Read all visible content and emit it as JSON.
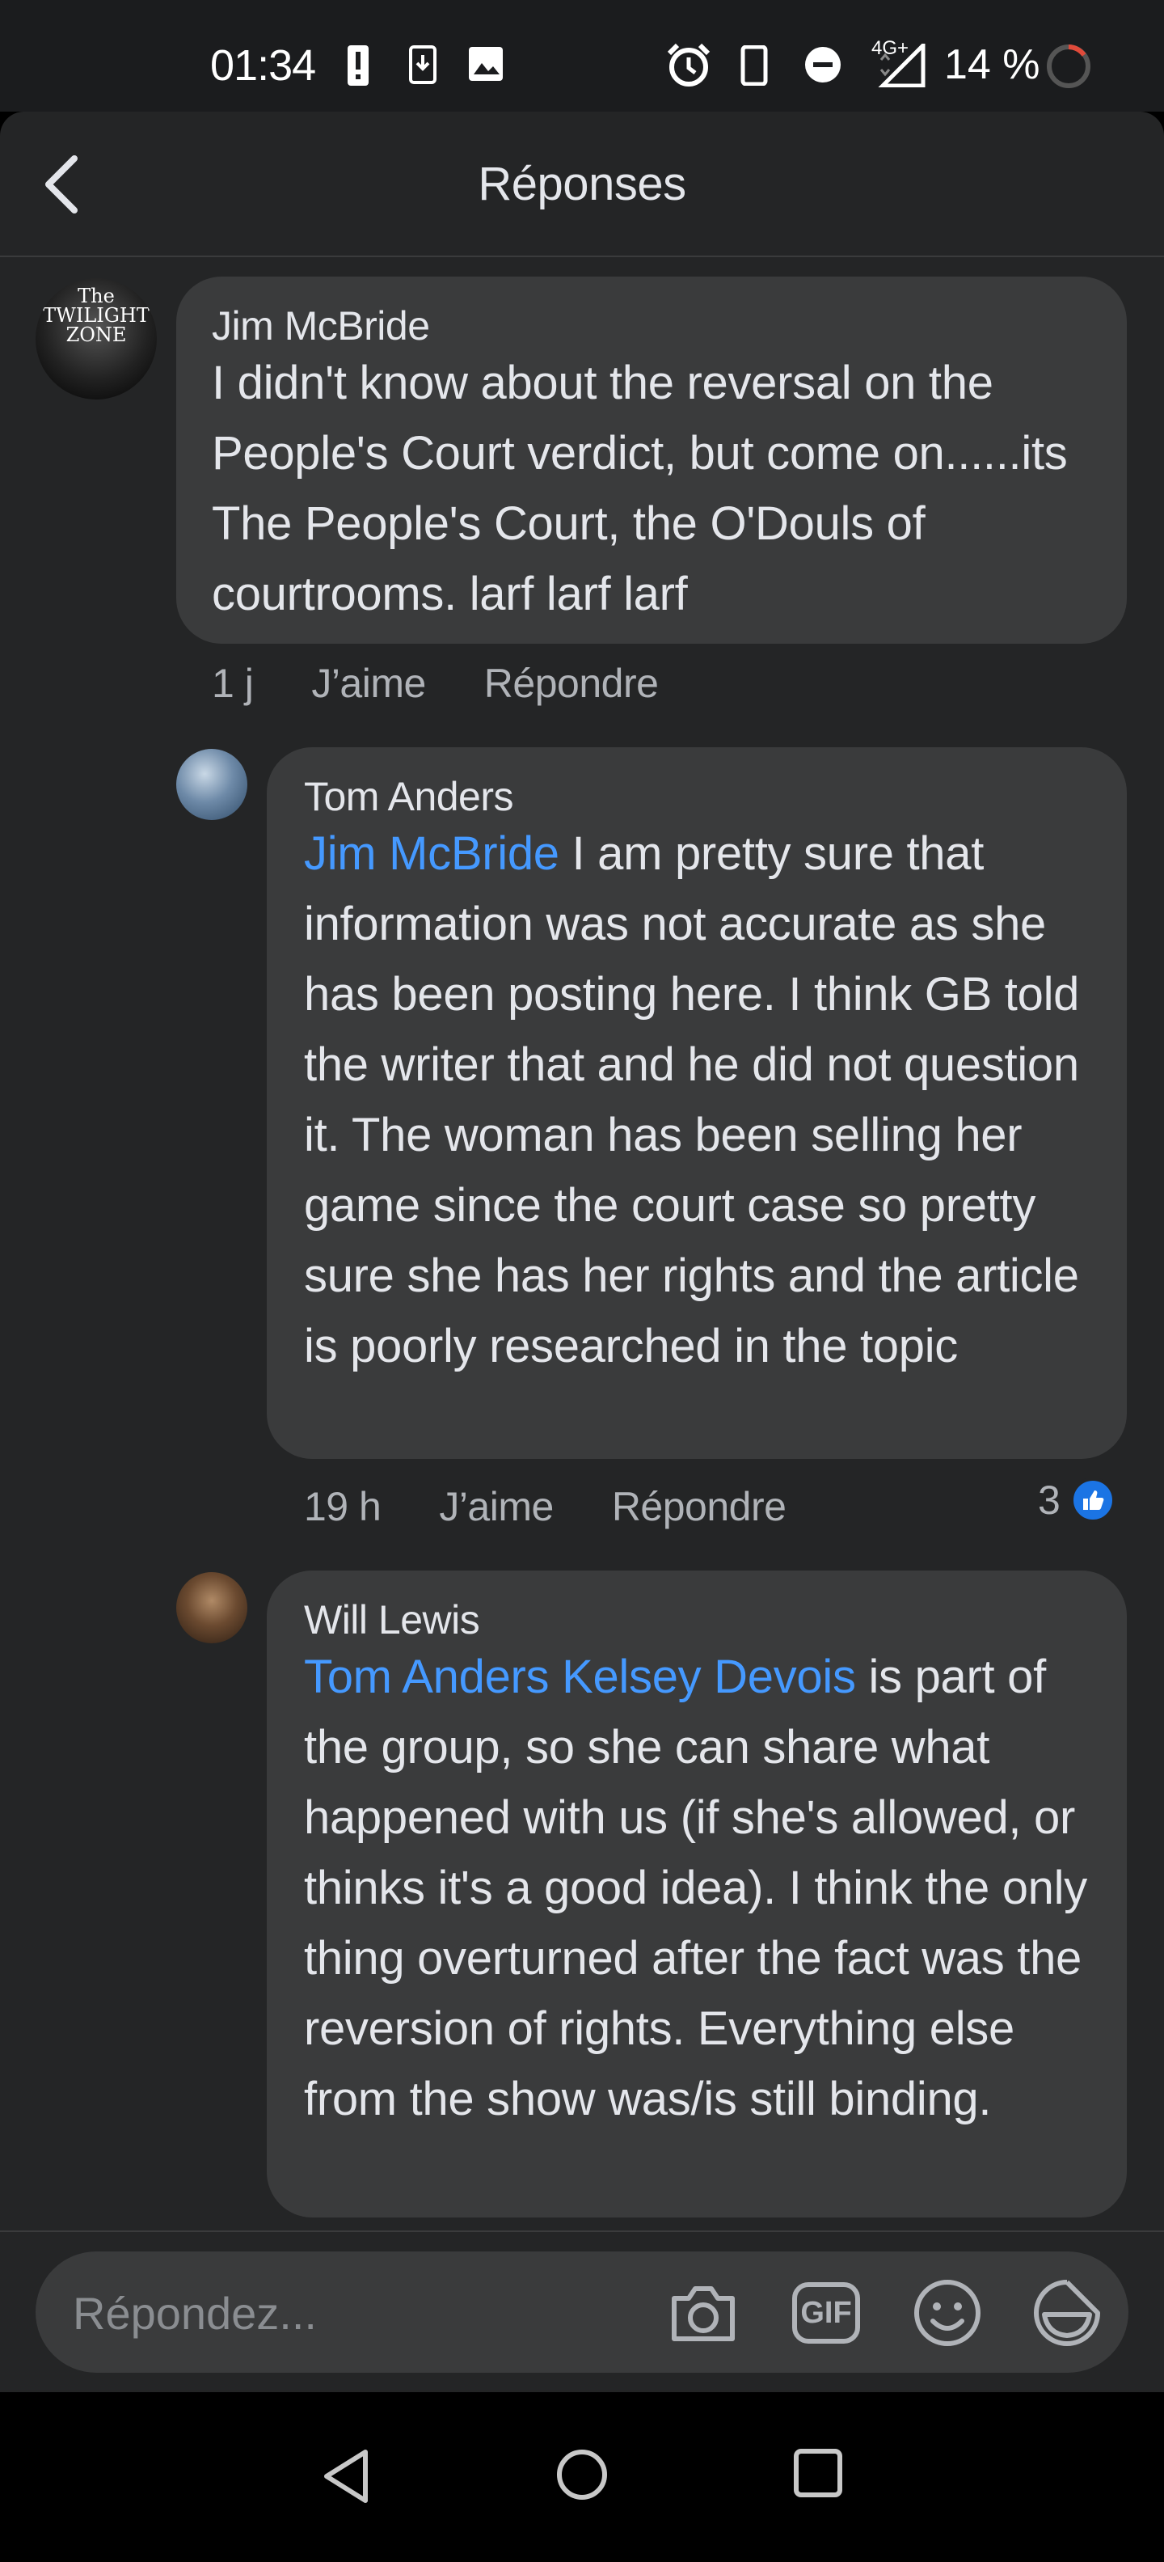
{
  "status_bar": {
    "time": "01:34",
    "battery": "14 %",
    "network": "4G+",
    "icons": [
      "alert-icon",
      "download-icon",
      "image-icon",
      "alarm-icon",
      "phone-icon",
      "dnd-icon",
      "signal-icon",
      "battery-icon"
    ]
  },
  "header": {
    "title": "Réponses",
    "back_icon": "back-arrow-icon"
  },
  "comments": [
    {
      "author": "Jim McBride",
      "avatar_text": [
        "The",
        "TWILIGHT",
        "ZONE"
      ],
      "mention": "",
      "text": "I didn't know about the reversal on the People's Court verdict, but come on......its The People's Court, the O'Douls of courtrooms. larf larf larf",
      "time": "1 j",
      "like_label": "J’aime",
      "reply_label": "Répondre",
      "likes": ""
    },
    {
      "author": "Tom Anders",
      "mention": "Jim McBride",
      "text": " I am pretty sure that information was not accurate as she has been posting here.  I think GB told the writer that and he did not question it.   The woman has been selling her game since the court case so pretty sure she has her rights and the article is poorly researched in the topic",
      "time": "19 h",
      "like_label": "J’aime",
      "reply_label": "Répondre",
      "likes": "3"
    },
    {
      "author": "Will Lewis",
      "mention": "Tom Anders Kelsey Devois",
      "text": " is part of the group, so she can share what happened with us (if she's allowed, or thinks it's a good idea). I think the only thing overturned after the fact was the reversion of rights. Everything else from the show was/is still binding.",
      "time": "",
      "like_label": "",
      "reply_label": "",
      "likes": ""
    }
  ],
  "composer": {
    "placeholder": "Répondez...",
    "icons": [
      "camera-icon",
      "gif-icon",
      "emoji-icon",
      "sticker-icon"
    ],
    "gif_label": "GIF"
  },
  "colors": {
    "background": "#242526",
    "bubble": "#3a3b3c",
    "mention": "#4599ff",
    "like_badge": "#1b74e4",
    "text_primary": "#e4e6eb",
    "text_secondary": "#b0b3b8"
  }
}
